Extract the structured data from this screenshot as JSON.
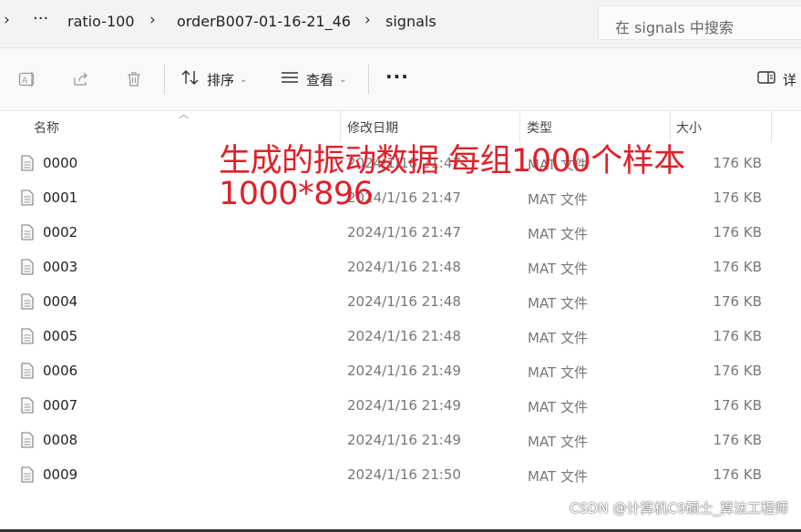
{
  "breadcrumb": {
    "more": "···",
    "items": [
      "ratio-100",
      "orderB007-01-16-21_46",
      "signals"
    ]
  },
  "search": {
    "placeholder": "在 signals 中搜索"
  },
  "toolbar": {
    "sort_label": "排序",
    "view_label": "查看",
    "more_label": "···",
    "details_label": "详"
  },
  "columns": {
    "name": "名称",
    "date": "修改日期",
    "type": "类型",
    "size": "大小"
  },
  "files": [
    {
      "name": "0000",
      "date": "2024/1/16 21:47",
      "type": "MAT 文件",
      "size": "176 KB"
    },
    {
      "name": "0001",
      "date": "2024/1/16 21:47",
      "type": "MAT 文件",
      "size": "176 KB"
    },
    {
      "name": "0002",
      "date": "2024/1/16 21:47",
      "type": "MAT 文件",
      "size": "176 KB"
    },
    {
      "name": "0003",
      "date": "2024/1/16 21:48",
      "type": "MAT 文件",
      "size": "176 KB"
    },
    {
      "name": "0004",
      "date": "2024/1/16 21:48",
      "type": "MAT 文件",
      "size": "176 KB"
    },
    {
      "name": "0005",
      "date": "2024/1/16 21:48",
      "type": "MAT 文件",
      "size": "176 KB"
    },
    {
      "name": "0006",
      "date": "2024/1/16 21:49",
      "type": "MAT 文件",
      "size": "176 KB"
    },
    {
      "name": "0007",
      "date": "2024/1/16 21:49",
      "type": "MAT 文件",
      "size": "176 KB"
    },
    {
      "name": "0008",
      "date": "2024/1/16 21:49",
      "type": "MAT 文件",
      "size": "176 KB"
    },
    {
      "name": "0009",
      "date": "2024/1/16 21:50",
      "type": "MAT 文件",
      "size": "176 KB"
    }
  ],
  "annotation": {
    "line1": "生成的振动数据 每组1000个样本",
    "line2": "1000*896",
    "color": "#e0202a"
  },
  "watermark": "CSDN @计算机C9硕士_算法工程师"
}
